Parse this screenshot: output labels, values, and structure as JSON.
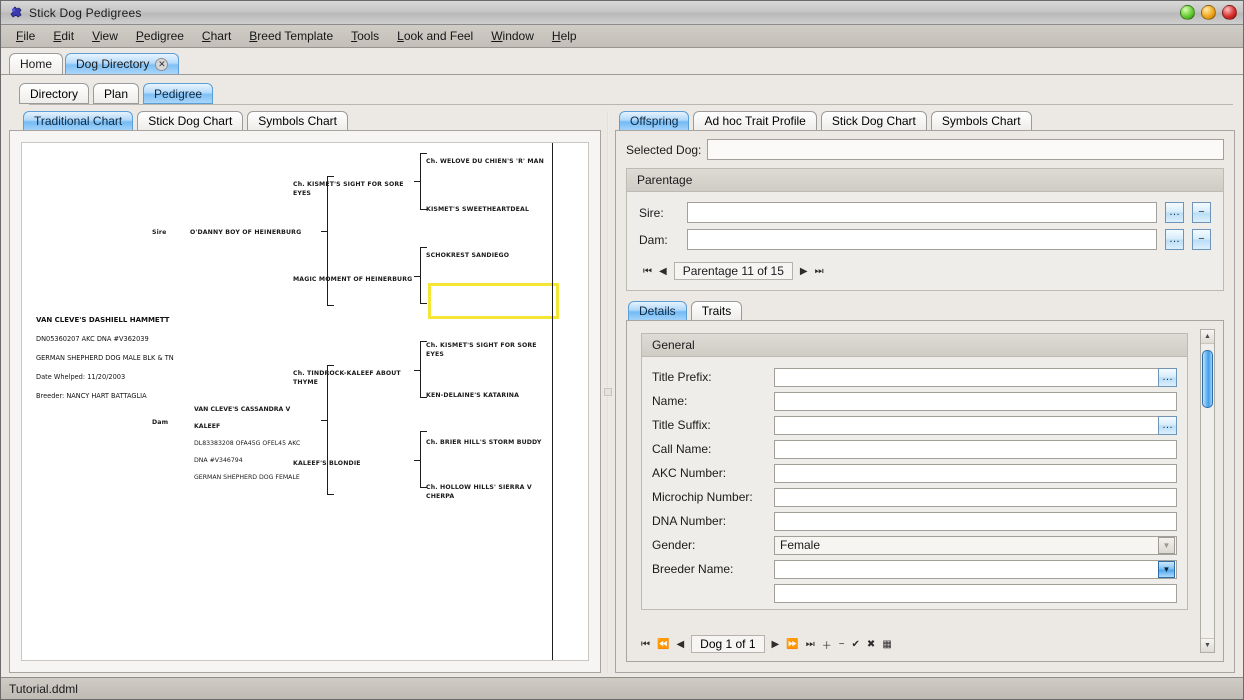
{
  "window": {
    "title": "Stick Dog Pedigrees",
    "icon": "app-puzzle-icon",
    "buttons": {
      "minimize": "minimize",
      "maximize": "maximize",
      "close": "close"
    }
  },
  "menubar": {
    "items": [
      {
        "label": "File",
        "mnemonic": "F"
      },
      {
        "label": "Edit",
        "mnemonic": "E"
      },
      {
        "label": "View",
        "mnemonic": "V"
      },
      {
        "label": "Pedigree",
        "mnemonic": "P"
      },
      {
        "label": "Chart",
        "mnemonic": "C"
      },
      {
        "label": "Breed Template",
        "mnemonic": "B"
      },
      {
        "label": "Tools",
        "mnemonic": "T"
      },
      {
        "label": "Look and Feel",
        "mnemonic": "L"
      },
      {
        "label": "Window",
        "mnemonic": "W"
      },
      {
        "label": "Help",
        "mnemonic": "H"
      }
    ]
  },
  "doc_tabs": [
    {
      "label": "Home",
      "active": false,
      "closable": false
    },
    {
      "label": "Dog Directory",
      "active": true,
      "closable": true,
      "close_glyph": "✕"
    }
  ],
  "view_tabs": [
    {
      "label": "Directory",
      "active": false
    },
    {
      "label": "Plan",
      "active": false
    },
    {
      "label": "Pedigree",
      "active": true
    }
  ],
  "left_pane": {
    "chart_tabs": [
      {
        "label": "Traditional Chart",
        "active": true
      },
      {
        "label": "Stick Dog Chart",
        "active": false
      },
      {
        "label": "Symbols Chart",
        "active": false
      }
    ],
    "pedigree": {
      "subject": {
        "lines": [
          "VAN CLEVE'S DASHIELL HAMMETT",
          "DN05360207  AKC  DNA #V362039",
          "GERMAN SHEPHERD DOG MALE BLK & TN",
          "Date  Whelped:  11/20/2003",
          "Breeder: NANCY  HART  BATTAGLIA"
        ]
      },
      "sire_label": "Sire",
      "dam_label": "Dam",
      "sire": {
        "name": "O'DANNY BOY OF HEINERBURG"
      },
      "dam": {
        "lines": [
          "VAN CLEVE'S CASSANDRA V",
          "KALEEF",
          "DL83383208 OFA45G OFEL45 AKC",
          "DNA #V346794",
          "GERMAN SHEPHERD DOG FEMALE"
        ]
      },
      "gen3": [
        {
          "name": "Ch. KISMET'S SIGHT FOR SORE\nEYES"
        },
        {
          "name": "MAGIC MOMENT OF HEINERBURG"
        },
        {
          "name": "Ch. TINDROCK-KALEEF ABOUT\nTHYME"
        },
        {
          "name": "KALEEF'S BLONDIE"
        }
      ],
      "gen4": [
        {
          "name": "Ch. WELOVE DU CHIEN'S 'R' MAN",
          "selected": false
        },
        {
          "name": "KISMET'S SWEETHEARTDEAL",
          "selected": false
        },
        {
          "name": "SCHOKREST SANDIEGO",
          "selected": false
        },
        {
          "name": "",
          "selected": true
        },
        {
          "name": "Ch. KISMET'S SIGHT FOR SORE\nEYES",
          "selected": false
        },
        {
          "name": "KEN-DELAINE'S KATARINA",
          "selected": false
        },
        {
          "name": "Ch. BRIER HILL'S STORM BUDDY",
          "selected": false
        },
        {
          "name": "Ch. HOLLOW HILLS' SIERRA V\nCHERPA",
          "selected": false
        }
      ]
    }
  },
  "right_pane": {
    "tabs": [
      {
        "label": "Offspring",
        "active": true
      },
      {
        "label": "Ad hoc Trait Profile",
        "active": false
      },
      {
        "label": "Stick Dog Chart",
        "active": false
      },
      {
        "label": "Symbols Chart",
        "active": false
      }
    ],
    "selected_dog": {
      "label": "Selected Dog:",
      "value": ""
    },
    "parentage": {
      "title": "Parentage",
      "sire": {
        "label": "Sire:",
        "value": "",
        "browse_glyph": "…",
        "clear_glyph": "−"
      },
      "dam": {
        "label": "Dam:",
        "value": "",
        "browse_glyph": "…",
        "clear_glyph": "−"
      },
      "nav": {
        "first_glyph": "⏮",
        "prev_glyph": "◀",
        "label": "Parentage 11 of 15",
        "next_glyph": "▶",
        "last_glyph": "⏭"
      }
    },
    "detail_tabs": [
      {
        "label": "Details",
        "active": true
      },
      {
        "label": "Traits",
        "active": false
      }
    ],
    "general": {
      "title": "General",
      "fields": [
        {
          "label": "Title Prefix:",
          "value": "",
          "type": "text-ellipsis",
          "ellipsis_glyph": "…"
        },
        {
          "label": "Name:",
          "value": "",
          "type": "text"
        },
        {
          "label": "Title Suffix:",
          "value": "",
          "type": "text-ellipsis",
          "ellipsis_glyph": "…"
        },
        {
          "label": "Call Name:",
          "value": "",
          "type": "text"
        },
        {
          "label": "AKC Number:",
          "value": "",
          "type": "text"
        },
        {
          "label": "Microchip Number:",
          "value": "",
          "type": "text"
        },
        {
          "label": "DNA Number:",
          "value": "",
          "type": "text"
        },
        {
          "label": "Gender:",
          "value": "Female",
          "type": "combo-readonly",
          "arrow_glyph": "▼"
        },
        {
          "label": "Breeder Name:",
          "value": "",
          "type": "combo-active",
          "arrow_glyph": "▼"
        }
      ]
    },
    "scrollbar": {
      "up_glyph": "▲",
      "down_glyph": "▼"
    },
    "record_nav": {
      "first_glyph": "⏮",
      "prev_page_glyph": "⏪",
      "prev_glyph": "◀",
      "label": "Dog 1 of 1",
      "next_glyph": "▶",
      "next_page_glyph": "⏩",
      "last_glyph": "⏭",
      "add_glyph": "＋",
      "remove_glyph": "−",
      "commit_glyph": "✔",
      "cancel_glyph": "✖",
      "grid_glyph": "▦"
    }
  },
  "statusbar": {
    "text": "Tutorial.ddml"
  },
  "colors": {
    "accent_blue": "#7fc0f5",
    "selection_yellow": "#f5e636",
    "window_bg": "#ece9e4",
    "chart_bg": "#ffffff"
  }
}
